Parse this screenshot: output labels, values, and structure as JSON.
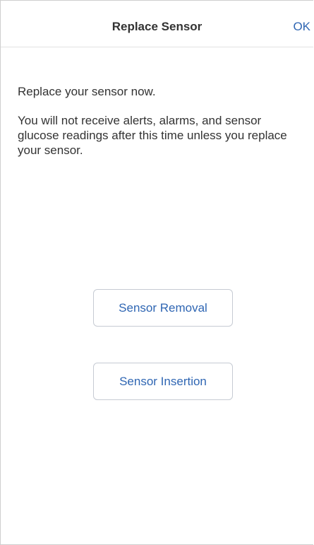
{
  "nav": {
    "title": "Replace Sensor",
    "ok_label": "OK"
  },
  "body": {
    "line1": "Replace your sensor now.",
    "line2": "You will not receive alerts, alarms, and sensor glucose readings after this time unless you replace your sensor."
  },
  "buttons": {
    "removal_label": "Sensor Removal",
    "insertion_label": "Sensor Insertion"
  },
  "colors": {
    "accent": "#2f66b3",
    "text": "#333333"
  }
}
